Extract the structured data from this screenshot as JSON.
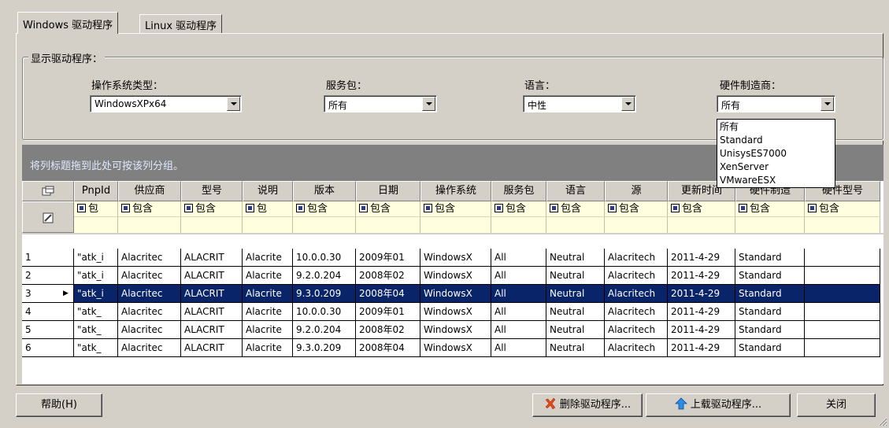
{
  "tabs": [
    {
      "label": "Windows 驱动程序",
      "active": true
    },
    {
      "label": "Linux 驱动程序",
      "active": false
    }
  ],
  "group": {
    "title": "显示驱动程序："
  },
  "filters": {
    "os_type": {
      "label": "操作系统类型：",
      "value": "WindowsXPx64"
    },
    "service_pack": {
      "label": "服务包：",
      "value": "所有"
    },
    "language": {
      "label": "语言：",
      "value": "中性"
    },
    "manufacturer": {
      "label": "硬件制造商：",
      "value": "所有",
      "options": [
        "所有",
        "Standard",
        "UnisysES7000",
        "XenServer",
        "VMwareESX"
      ]
    }
  },
  "group_hint": "将列标题拖到此处可按该列分组。",
  "grid": {
    "columns": [
      "PnpId",
      "供应商",
      "型号",
      "说明",
      "版本",
      "日期",
      "操作系统",
      "服务包",
      "语言",
      "源",
      "更新时间",
      "硬件制造",
      "硬件型号"
    ],
    "filter_labels": [
      "包",
      "包含",
      "包含",
      "包",
      "包含",
      "包含",
      "包含",
      "包含",
      "包含",
      "包含",
      "包含",
      "包含",
      "包含"
    ],
    "selected_row": 3,
    "rows": [
      {
        "num": "1",
        "cells": [
          "\"atk_i",
          "Alacritec",
          "ALACRIT",
          "Alacrite",
          "10.0.0.30",
          "2009年01",
          "WindowsX",
          "All",
          "Neutral",
          "Alacritech",
          "2011-4-29",
          "Standard",
          ""
        ]
      },
      {
        "num": "2",
        "cells": [
          "\"atk_i",
          "Alacritec",
          "ALACRIT",
          "Alacrite",
          "9.2.0.204",
          "2008年02",
          "WindowsX",
          "All",
          "Neutral",
          "Alacritech",
          "2011-4-29",
          "Standard",
          ""
        ]
      },
      {
        "num": "3",
        "cells": [
          "\"atk_i",
          "Alacritec",
          "ALACRIT",
          "Alacrite",
          "9.3.0.209",
          "2008年04",
          "WindowsX",
          "All",
          "Neutral",
          "Alacritech",
          "2011-4-29",
          "Standard",
          ""
        ]
      },
      {
        "num": "4",
        "cells": [
          "\"atk_",
          "Alacritec",
          "ALACRIT",
          "Alacrite",
          "10.0.0.30",
          "2009年01",
          "WindowsX",
          "All",
          "Neutral",
          "Alacritech",
          "2011-4-29",
          "Standard",
          ""
        ]
      },
      {
        "num": "5",
        "cells": [
          "\"atk_",
          "Alacritec",
          "ALACRIT",
          "Alacrite",
          "9.2.0.204",
          "2008年02",
          "WindowsX",
          "All",
          "Neutral",
          "Alacritech",
          "2011-4-29",
          "Standard",
          ""
        ]
      },
      {
        "num": "6",
        "cells": [
          "\"atk_",
          "Alacritec",
          "ALACRIT",
          "Alacrite",
          "9.3.0.209",
          "2008年04",
          "WindowsX",
          "All",
          "Neutral",
          "Alacritech",
          "2011-4-29",
          "Standard",
          ""
        ]
      }
    ]
  },
  "buttons": {
    "help": "帮助(H)",
    "delete": "删除驱动程序...",
    "upload": "上载驱动程序...",
    "close": "关闭"
  },
  "colors": {
    "selection": "#0a246a",
    "filter_row": "#ffffe0",
    "group_band": "#808080",
    "face": "#d4d0c8"
  }
}
